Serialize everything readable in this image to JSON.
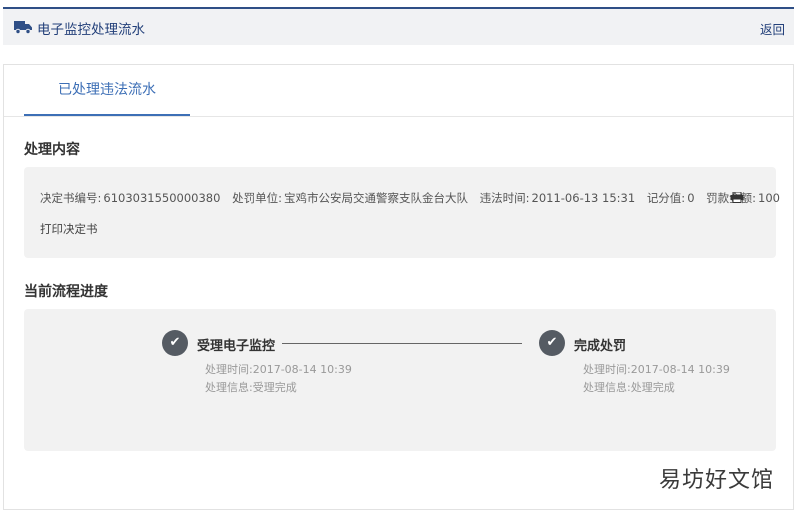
{
  "header": {
    "title": "电子监控处理流水",
    "back_label": "返回",
    "icon": "truck-icon"
  },
  "tabs": [
    {
      "label": "已处理违法流水",
      "active": true
    }
  ],
  "content_section": {
    "title": "处理内容",
    "decision_no_label": "决定书编号:",
    "decision_no": "6103031550000380",
    "dept_label": "处罚单位:",
    "dept": "宝鸡市公安局交通警察支队金台大队",
    "time_label": "违法时间:",
    "time": "2011-06-13 15:31",
    "score_label": "记分值:",
    "score": "0",
    "fine_label": "罚款金额:",
    "fine": "100",
    "print_label": "打印决定书"
  },
  "progress_section": {
    "title": "当前流程进度",
    "steps": [
      {
        "name": "受理电子监控",
        "time": "处理时间:2017-08-14 10:39",
        "info": "处理信息:受理完成",
        "icon": "check-icon"
      },
      {
        "name": "完成处罚",
        "time": "处理时间:2017-08-14 10:39",
        "info": "处理信息:处理完成",
        "icon": "check-icon"
      }
    ]
  },
  "watermark": "易坊好文馆",
  "colors": {
    "brand": "#23407a",
    "tab_active": "#3d6fb6",
    "panel_bg": "#f2f2f2",
    "step_circle": "#555b63"
  }
}
